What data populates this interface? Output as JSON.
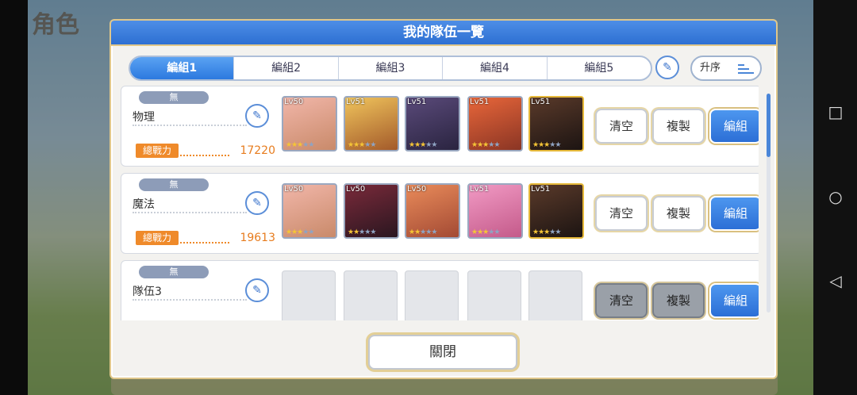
{
  "background": {
    "title_fragment": "角色",
    "colors": {
      "dim": "#000000"
    }
  },
  "dialog": {
    "title": "我的隊伍一覽",
    "tabs": [
      "編組1",
      "編組2",
      "編組3",
      "編組4",
      "編組5"
    ],
    "active_tab": 0,
    "sort_label": "升序",
    "close_label": "關閉"
  },
  "teams": [
    {
      "tag": "無",
      "name": "物理",
      "power_label": "總戰力",
      "power_value": "17220",
      "members": [
        {
          "level": "Lv50",
          "stars": 3,
          "colors": [
            "#f1b6a9",
            "#c98a6a"
          ]
        },
        {
          "level": "Lv51",
          "stars": 3,
          "colors": [
            "#f0c45c",
            "#a35a2a"
          ]
        },
        {
          "level": "Lv51",
          "stars": 3,
          "colors": [
            "#5a4a7a",
            "#2a2440"
          ]
        },
        {
          "level": "Lv51",
          "stars": 3,
          "colors": [
            "#e8663a",
            "#8a3524"
          ]
        },
        {
          "level": "Lv51",
          "stars": 3,
          "colors": [
            "#5a3a2a",
            "#1c1412"
          ],
          "gold": true
        }
      ],
      "actions": {
        "clear": "清空",
        "copy": "複製",
        "edit": "編組"
      },
      "enabled": true
    },
    {
      "tag": "無",
      "name": "魔法",
      "power_label": "總戰力",
      "power_value": "19613",
      "members": [
        {
          "level": "Lv50",
          "stars": 3,
          "colors": [
            "#f1b6a9",
            "#c98a6a"
          ]
        },
        {
          "level": "Lv50",
          "stars": 2,
          "colors": [
            "#7a2a3a",
            "#2a1620"
          ]
        },
        {
          "level": "Lv50",
          "stars": 2,
          "colors": [
            "#e98b5a",
            "#a34a34"
          ]
        },
        {
          "level": "Lv51",
          "stars": 3,
          "colors": [
            "#f19ac4",
            "#c45a8a"
          ]
        },
        {
          "level": "Lv51",
          "stars": 3,
          "colors": [
            "#5a3a2a",
            "#1c1412"
          ],
          "gold": true
        }
      ],
      "actions": {
        "clear": "清空",
        "copy": "複製",
        "edit": "編組"
      },
      "enabled": true
    },
    {
      "tag": "無",
      "name": "隊伍3",
      "power_label": "",
      "power_value": "",
      "members": [],
      "actions": {
        "clear": "清空",
        "copy": "複製",
        "edit": "編組"
      },
      "enabled": false
    }
  ],
  "system_nav": {
    "recent": "□",
    "home": "○",
    "back": "◁"
  }
}
